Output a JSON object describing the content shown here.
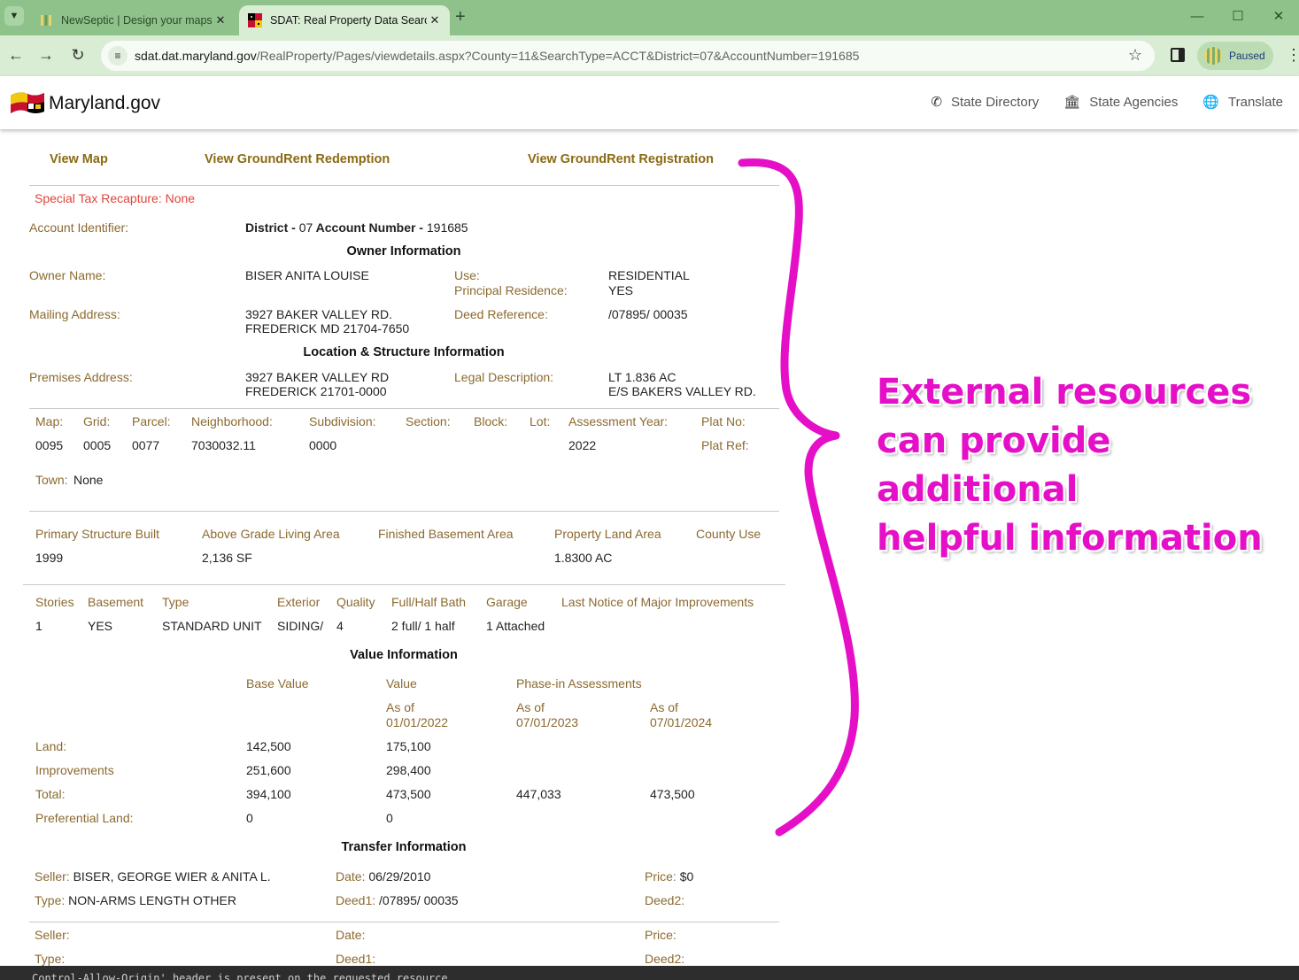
{
  "browser": {
    "tabs": [
      {
        "title": "NewSeptic | Design your maps",
        "active": false
      },
      {
        "title": "SDAT: Real Property Data Search",
        "active": true
      }
    ],
    "url_domain": "sdat.dat.maryland.gov",
    "url_path": "/RealProperty/Pages/viewdetails.aspx?County=11&SearchType=ACCT&District=07&AccountNumber=191685",
    "profile_label": "Paused"
  },
  "site_header": {
    "brand": "Maryland.gov",
    "nav": [
      "State Directory",
      "State Agencies",
      "Translate"
    ]
  },
  "links": {
    "view_map": "View Map",
    "groundrent_redemption": "View GroundRent Redemption",
    "groundrent_registration": "View GroundRent Registration"
  },
  "special_tax": "Special Tax Recapture: None",
  "account": {
    "label": "Account Identifier:",
    "district_label": "District - ",
    "district": "07",
    "acct_label": " Account Number - ",
    "acct": "191685"
  },
  "owner": {
    "heading": "Owner Information",
    "name_label": "Owner Name:",
    "name": "BISER ANITA LOUISE",
    "use_label": "Use:",
    "use": "RESIDENTIAL",
    "principal_label": "Principal Residence:",
    "principal": "YES",
    "mailing_label": "Mailing Address:",
    "mailing_1": "3927 BAKER VALLEY RD.",
    "mailing_2": "FREDERICK MD 21704-7650",
    "deed_label": "Deed Reference:",
    "deed": "/07895/ 00035"
  },
  "location": {
    "heading": "Location & Structure Information",
    "premises_label": "Premises Address:",
    "premises_1": "3927 BAKER VALLEY RD",
    "premises_2": "FREDERICK 21701-0000",
    "legal_label": "Legal Description:",
    "legal_1": "LT 1.836 AC",
    "legal_2": "E/S BAKERS VALLEY RD."
  },
  "parcel": {
    "headers": [
      "Map:",
      "Grid:",
      "Parcel:",
      "Neighborhood:",
      "Subdivision:",
      "Section:",
      "Block:",
      "Lot:",
      "Assessment Year:",
      "Plat No:"
    ],
    "values": [
      "0095",
      "0005",
      "0077",
      "7030032.11",
      "0000",
      "",
      "",
      "",
      "2022"
    ],
    "plat_ref_label": "Plat Ref:",
    "town_label": "Town:",
    "town": "None"
  },
  "structure": {
    "headers": [
      "Primary Structure Built",
      "Above Grade Living Area",
      "Finished Basement Area",
      "Property Land Area",
      "County Use"
    ],
    "values": [
      "1999",
      "2,136 SF",
      "",
      "1.8300 AC",
      ""
    ]
  },
  "details": {
    "headers": [
      "Stories",
      "Basement",
      "Type",
      "Exterior",
      "Quality",
      "Full/Half Bath",
      "Garage",
      "Last Notice of Major Improvements"
    ],
    "values": [
      "1",
      "YES",
      "STANDARD UNIT",
      "SIDING/",
      "4",
      "2 full/ 1 half",
      "1 Attached",
      ""
    ]
  },
  "value": {
    "heading": "Value Information",
    "base_value": "Base Value",
    "value": "Value",
    "phase_in": "Phase-in Assessments",
    "as_of": "As of",
    "date_1": "01/01/2022",
    "date_2": "07/01/2023",
    "date_3": "07/01/2024",
    "rows": [
      {
        "label": "Land:",
        "base": "142,500",
        "val": "175,100",
        "p1": "",
        "p2": ""
      },
      {
        "label": "Improvements",
        "base": "251,600",
        "val": "298,400",
        "p1": "",
        "p2": ""
      },
      {
        "label": "Total:",
        "base": "394,100",
        "val": "473,500",
        "p1": "447,033",
        "p2": "473,500"
      },
      {
        "label": "Preferential Land:",
        "base": "0",
        "val": "0",
        "p1": "",
        "p2": ""
      }
    ]
  },
  "transfer": {
    "heading": "Transfer Information",
    "seller_label": "Seller:",
    "seller": "BISER, GEORGE WIER & ANITA L.",
    "date_label": "Date:",
    "date": "06/29/2010",
    "price_label": "Price:",
    "price": "$0",
    "type_label": "Type:",
    "type": "NON-ARMS LENGTH OTHER",
    "deed1_label": "Deed1:",
    "deed1": "/07895/ 00035",
    "deed2_label": "Deed2:",
    "deed2": ""
  },
  "annotation": {
    "line1": "External resources",
    "line2": "can provide additional",
    "line3": "helpful information",
    "color": "#e60fc8"
  },
  "console_text": "Control-Allow-Origin' header is present on the requested resource."
}
